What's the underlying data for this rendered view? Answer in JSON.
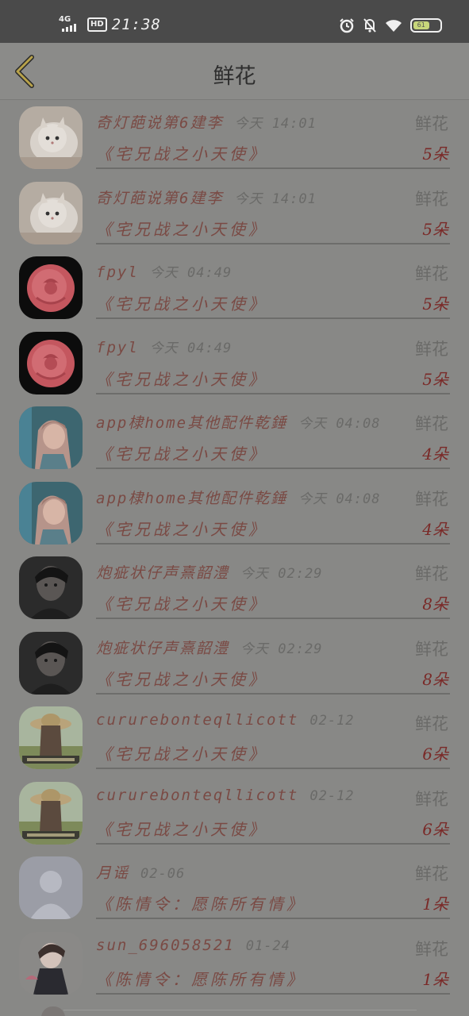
{
  "status_bar": {
    "network": "4G",
    "hd": "HD",
    "time": "21:38",
    "battery": "61"
  },
  "nav": {
    "title": "鲜花"
  },
  "items": [
    {
      "name": "奇灯葩说第6建李",
      "time": "今天 14:01",
      "type": "鲜花",
      "title": "《宅兄战之小天使》",
      "count": "5朵",
      "avatar": "cat-avatar"
    },
    {
      "name": "奇灯葩说第6建李",
      "time": "今天 14:01",
      "type": "鲜花",
      "title": "《宅兄战之小天使》",
      "count": "5朵",
      "avatar": "cat-avatar"
    },
    {
      "name": "fpyl",
      "time": "今天 04:49",
      "type": "鲜花",
      "title": "《宅兄战之小天使》",
      "count": "5朵",
      "avatar": "rose-avatar"
    },
    {
      "name": "fpyl",
      "time": "今天 04:49",
      "type": "鲜花",
      "title": "《宅兄战之小天使》",
      "count": "5朵",
      "avatar": "rose-avatar"
    },
    {
      "name": "app棣home其他配件乾錘",
      "time": "今天 04:08",
      "type": "鲜花",
      "title": "《宅兄战之小天使》",
      "count": "4朵",
      "avatar": "anime-girl-avatar"
    },
    {
      "name": "app棣home其他配件乾錘",
      "time": "今天 04:08",
      "type": "鲜花",
      "title": "《宅兄战之小天使》",
      "count": "4朵",
      "avatar": "anime-girl-avatar"
    },
    {
      "name": "炮疵状仔声熹韶澧",
      "time": "今天 02:29",
      "type": "鲜花",
      "title": "《宅兄战之小天使》",
      "count": "8朵",
      "avatar": "dark-portrait-avatar"
    },
    {
      "name": "炮疵状仔声熹韶澧",
      "time": "今天 02:29",
      "type": "鲜花",
      "title": "《宅兄战之小天使》",
      "count": "8朵",
      "avatar": "dark-portrait-avatar"
    },
    {
      "name": "cururebonteqllicott",
      "time": "02-12",
      "type": "鲜花",
      "title": "《宅兄战之小天使》",
      "count": "6朵",
      "avatar": "straw-hat-girl-avatar"
    },
    {
      "name": "cururebonteqllicott",
      "time": "02-12",
      "type": "鲜花",
      "title": "《宅兄战之小天使》",
      "count": "6朵",
      "avatar": "straw-hat-girl-avatar"
    },
    {
      "name": "月谣",
      "time": "02-06",
      "type": "鲜花",
      "title": "《陈情令：愿陈所有情》",
      "count": "1朵",
      "avatar": "default-user-avatar"
    },
    {
      "name": "sun_696058521",
      "time": "01-24",
      "type": "鲜花",
      "title": "《陈情令：愿陈所有情》",
      "count": "1朵",
      "avatar": "anime-boy-avatar"
    }
  ]
}
